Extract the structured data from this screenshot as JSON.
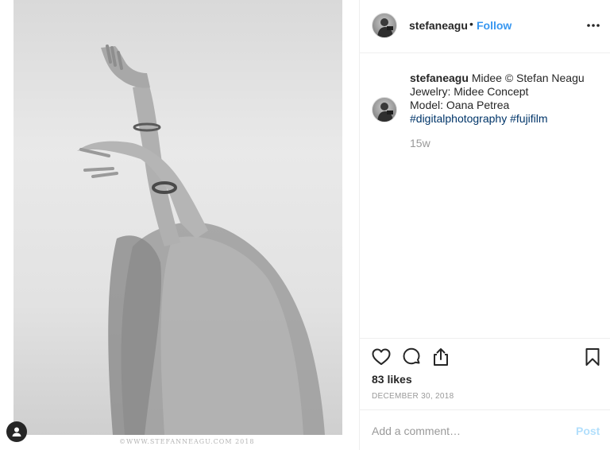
{
  "post": {
    "username": "stefaneagu",
    "separator": "•",
    "follow_label": "Follow",
    "more_icon": "more-options-icon",
    "watermark": "©WWW.STEFANNEAGU.COM 2018"
  },
  "caption": {
    "username": "stefaneagu",
    "title_text": "Midee © Stefan Neagu",
    "line2": "Jewelry: Midee Concept",
    "line3": "Model: Oana Petrea",
    "tag1": "#digitalphotography",
    "tag2": "#fujifilm",
    "time_ago": "15w"
  },
  "actions": {
    "like_icon": "heart-icon",
    "comment_icon": "comment-icon",
    "share_icon": "share-icon",
    "save_icon": "bookmark-icon",
    "likes_text": "83 likes",
    "date": "DECEMBER 30, 2018"
  },
  "comment_box": {
    "placeholder": "Add a comment…",
    "post_label": "Post"
  },
  "colors": {
    "follow": "#3897f0",
    "hashtag": "#003569",
    "muted": "#999999",
    "post_disabled": "#b2dffc"
  }
}
